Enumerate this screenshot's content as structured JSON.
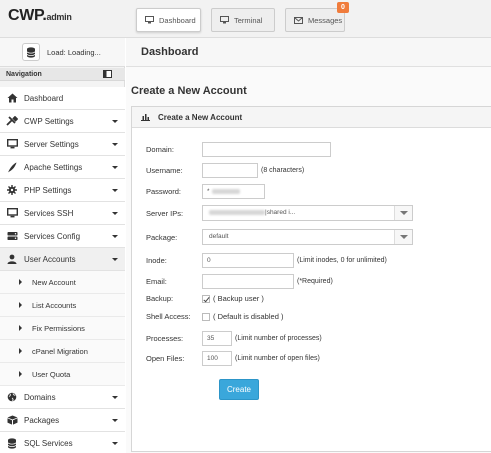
{
  "app": {
    "logo_main": "CWP.",
    "logo_sub": "admin"
  },
  "topnav": {
    "dashboard": "Dashboard",
    "terminal": "Terminal",
    "messages": "Messages",
    "messages_badge": "0"
  },
  "sidebar": {
    "load_text": "Load: Loading...",
    "nav_heading": "Navigation",
    "items": [
      {
        "label": "Dashboard",
        "icon": "home-icon"
      },
      {
        "label": "CWP Settings",
        "icon": "tools-icon"
      },
      {
        "label": "Server Settings",
        "icon": "monitor-icon"
      },
      {
        "label": "Apache Settings",
        "icon": "feather-icon"
      },
      {
        "label": "PHP Settings",
        "icon": "gear-icon"
      },
      {
        "label": "Services SSH",
        "icon": "monitor-icon"
      },
      {
        "label": "Services Config",
        "icon": "hdd-icon"
      },
      {
        "label": "User Accounts",
        "icon": "user-icon"
      }
    ],
    "subitems": [
      "New Account",
      "List Accounts",
      "Fix Permissions",
      "cPanel Migration",
      "User Quota"
    ],
    "items_after": [
      {
        "label": "Domains",
        "icon": "globe-icon"
      },
      {
        "label": "Packages",
        "icon": "package-icon"
      },
      {
        "label": "SQL Services",
        "icon": "database-icon"
      }
    ]
  },
  "main": {
    "page_title": "Dashboard",
    "section_title": "Create a New Account",
    "card_title": "Create a New Account",
    "form": {
      "domain_label": "Domain:",
      "domain_value": "",
      "username_label": "Username:",
      "username_value": "",
      "username_hint": "(8 characters)",
      "password_label": "Password:",
      "password_value": "*",
      "server_ips_label": "Server IPs:",
      "server_ips_value": "|shared i...",
      "package_label": "Package:",
      "package_value": "default",
      "inode_label": "Inode:",
      "inode_value": "0",
      "inode_hint": "(Limit inodes, 0 for unlimited)",
      "email_label": "Email:",
      "email_value": "",
      "email_hint": "(*Required)",
      "backup_label": "Backup:",
      "backup_checked": true,
      "backup_hint": "( Backup user )",
      "shell_label": "Shell Access:",
      "shell_checked": false,
      "shell_hint": "( Default is disabled )",
      "processes_label": "Processes:",
      "processes_value": "35",
      "processes_hint": "(Limit number of processes)",
      "openfiles_label": "Open Files:",
      "openfiles_value": "100",
      "openfiles_hint": "(Limit number of open files)",
      "create_label": "Create"
    }
  },
  "colors": {
    "accent": "#3aa7db",
    "badge": "#f07c3c"
  }
}
